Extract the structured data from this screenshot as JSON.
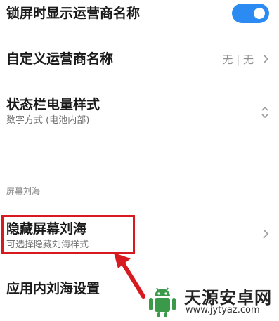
{
  "settings": {
    "lockscreen_carrier": {
      "title": "锁屏时显示运营商名称",
      "enabled": true,
      "toggle_color": "#2b8bf2"
    },
    "custom_carrier": {
      "title": "自定义运营商名称",
      "value": "无 | 无"
    },
    "battery_style": {
      "title": "状态栏电量样式",
      "subtitle": "数字方式 (电池内部)"
    },
    "section_notch": {
      "label": "屏幕刘海"
    },
    "hide_notch": {
      "title": "隐藏屏幕刘海",
      "subtitle": "可选择隐藏刘海样式"
    },
    "app_notch": {
      "title": "应用内刘海设置"
    }
  },
  "annotation": {
    "highlight_color": "#d71920"
  },
  "watermark": {
    "name": "天源安卓网",
    "url": "www.jytyaz.com"
  },
  "icons": {
    "toggle": "toggle-switch-icon",
    "chevron": "chevron-right-icon",
    "updown": "chevron-up-down-icon",
    "logo": "android-logo-icon",
    "arrow": "red-arrow-icon"
  }
}
